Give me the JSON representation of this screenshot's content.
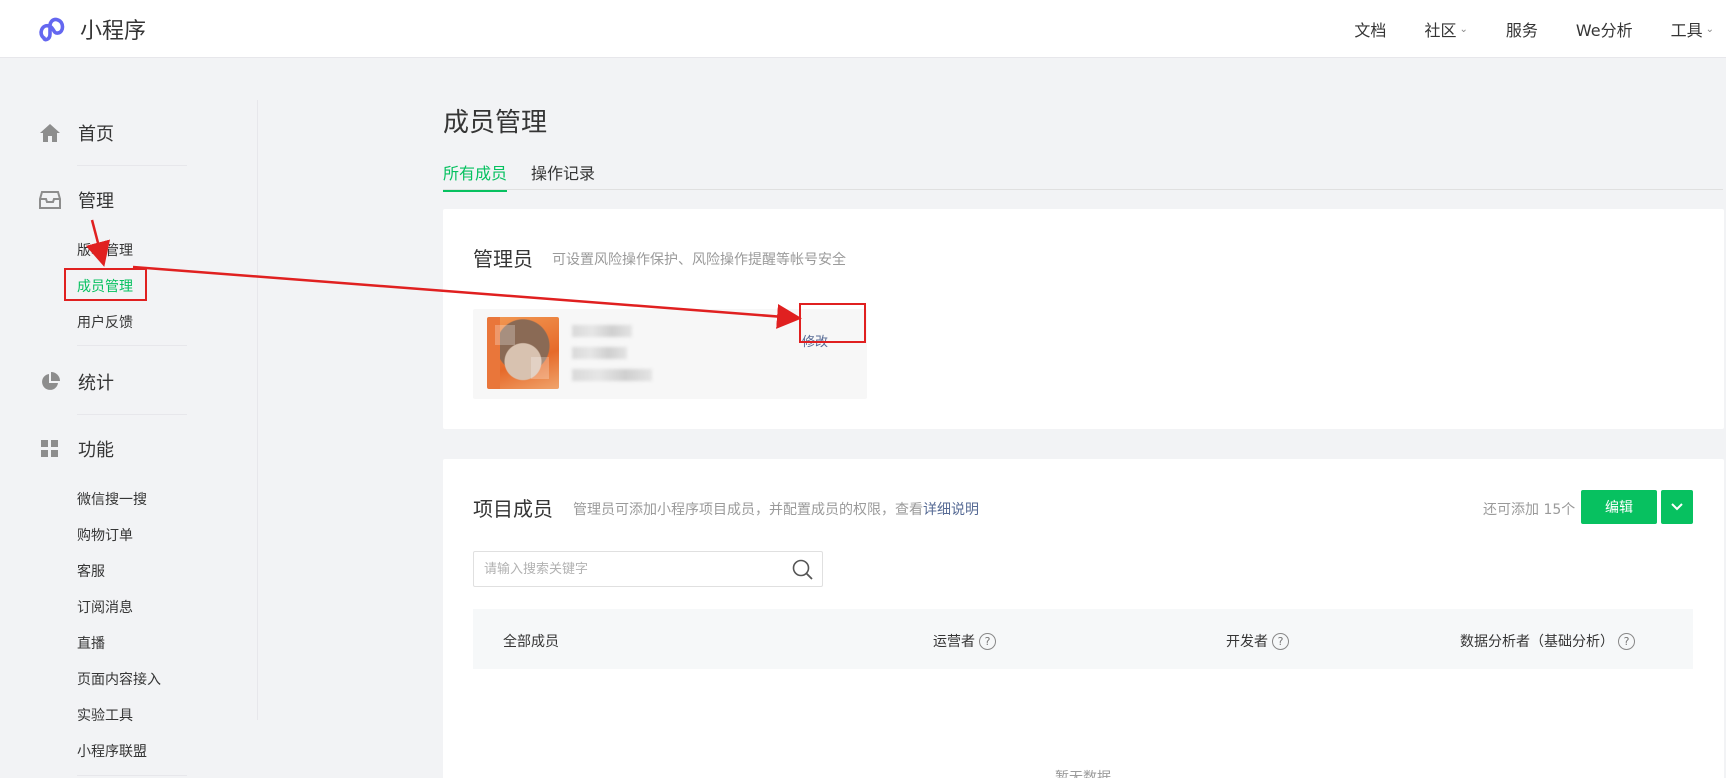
{
  "app": {
    "name": "小程序"
  },
  "topnav": [
    {
      "label": "文档",
      "dropdown": false
    },
    {
      "label": "社区",
      "dropdown": true
    },
    {
      "label": "服务",
      "dropdown": false
    },
    {
      "label": "We分析",
      "dropdown": false
    },
    {
      "label": "工具",
      "dropdown": true
    }
  ],
  "sidebar": {
    "home": "首页",
    "manage": "管理",
    "manage_items": [
      "版本管理",
      "成员管理",
      "用户反馈"
    ],
    "stats": "统计",
    "features": "功能",
    "feature_items": [
      "微信搜一搜",
      "购物订单",
      "客服",
      "订阅消息",
      "直播",
      "页面内容接入",
      "实验工具",
      "小程序联盟"
    ],
    "active_item": "成员管理"
  },
  "page": {
    "title": "成员管理",
    "tabs": [
      {
        "label": "所有成员",
        "active": true
      },
      {
        "label": "操作记录",
        "active": false
      }
    ]
  },
  "admin_card": {
    "title": "管理员",
    "desc": "可设置风险操作保护、风险操作提醒等帐号安全",
    "modify_label": "修改"
  },
  "members_card": {
    "title": "项目成员",
    "desc_prefix": "管理员可添加小程序项目成员，并配置成员的权限，查看",
    "desc_link": "详细说明",
    "quota_text": "还可添加 15个",
    "edit_label": "编辑",
    "search_placeholder": "请输入搜索关键字",
    "columns": [
      "全部成员",
      "运营者",
      "开发者",
      "数据分析者（基础分析）"
    ],
    "empty_text": "暂无数据"
  },
  "colors": {
    "brand_green": "#07c160",
    "link_blue": "#576b95",
    "annotation_red": "#e02020"
  }
}
